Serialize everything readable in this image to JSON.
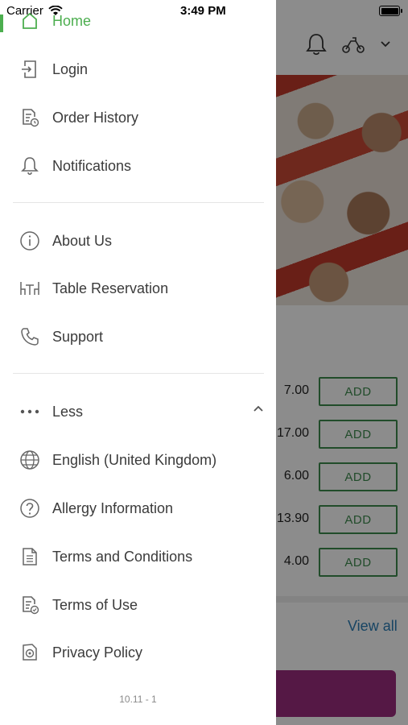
{
  "status_bar": {
    "carrier": "Carrier",
    "time": "3:49 PM"
  },
  "menu": {
    "items": [
      {
        "label": "Home",
        "icon": "home-icon",
        "active": true
      },
      {
        "label": "Login",
        "icon": "login-icon"
      },
      {
        "label": "Order History",
        "icon": "order-history-icon"
      },
      {
        "label": "Notifications",
        "icon": "bell-icon"
      },
      {
        "label": "About Us",
        "icon": "info-icon"
      },
      {
        "label": "Table Reservation",
        "icon": "table-icon"
      },
      {
        "label": "Support",
        "icon": "phone-icon"
      },
      {
        "label": "Less",
        "icon": "more-dots-icon"
      },
      {
        "label": "English (United Kingdom)",
        "icon": "globe-icon"
      },
      {
        "label": "Allergy Information",
        "icon": "question-icon"
      },
      {
        "label": "Terms and Conditions",
        "icon": "document-icon"
      },
      {
        "label": "Terms of Use",
        "icon": "document-check-icon"
      },
      {
        "label": "Privacy Policy",
        "icon": "privacy-icon"
      }
    ],
    "version": "10.11 - 1"
  },
  "background": {
    "prices": [
      "7.00",
      "17.00",
      "6.00",
      "13.90",
      "4.00"
    ],
    "add_label": "ADD",
    "view_all": "View all"
  },
  "colors": {
    "accent": "#4cae4f",
    "add_button": "#3d8a4e",
    "link": "#2a7db5",
    "cta": "#9b2d7f"
  }
}
